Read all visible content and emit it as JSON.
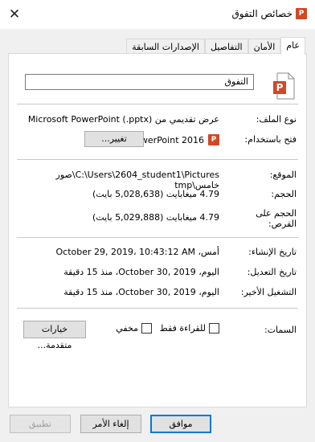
{
  "window": {
    "title": "خصائص التفوق",
    "close_glyph": "✕"
  },
  "tabs": [
    "عام",
    "الأمان",
    "التفاصيل",
    "الإصدارات السابقة"
  ],
  "file_name": "التفوق",
  "fields": {
    "type_label": "نوع الملف:",
    "type_value": "عرض تقديمي من Microsoft PowerPoint (.pptx)",
    "opens_label": "فتح باستخدام:",
    "opens_value": "PowerPoint 2016",
    "change_button": "تغيير...",
    "location_label": "الموقع:",
    "location_value": "C:\\Users\\2604_student1\\Pictures\\صور خامس\\tmp",
    "size_label": "الحجم:",
    "size_value": "4.79 ميغابايت (5,028,638 بايت)",
    "disk_label_1": "الحجم على",
    "disk_label_2": "القرص:",
    "disk_value": "4.79 ميغابايت (5,029,888 بايت)",
    "created_label": "تاريخ الإنشاء:",
    "created_value": "أمس، October 29, 2019، 10:43:12 AM",
    "modified_label": "تاريخ التعديل:",
    "modified_value": "اليوم، October 30, 2019، منذ 15 دقيقة",
    "accessed_label": "التشغيل الأخير:",
    "accessed_value": "اليوم، October 30, 2019، منذ 15 دقيقة",
    "attributes_label": "السمات:",
    "readonly_label": "للقراءة فقط",
    "hidden_label": "مخفي",
    "advanced_button": "خيارات متقدمة..."
  },
  "buttons": {
    "ok": "موافق",
    "cancel": "إلغاء الأمر",
    "apply": "تطبيق"
  },
  "colors": {
    "accent": "#0078d7",
    "ppt": "#d24726"
  },
  "icons": {
    "close": "close-icon",
    "ppt": "powerpoint-file-icon"
  }
}
